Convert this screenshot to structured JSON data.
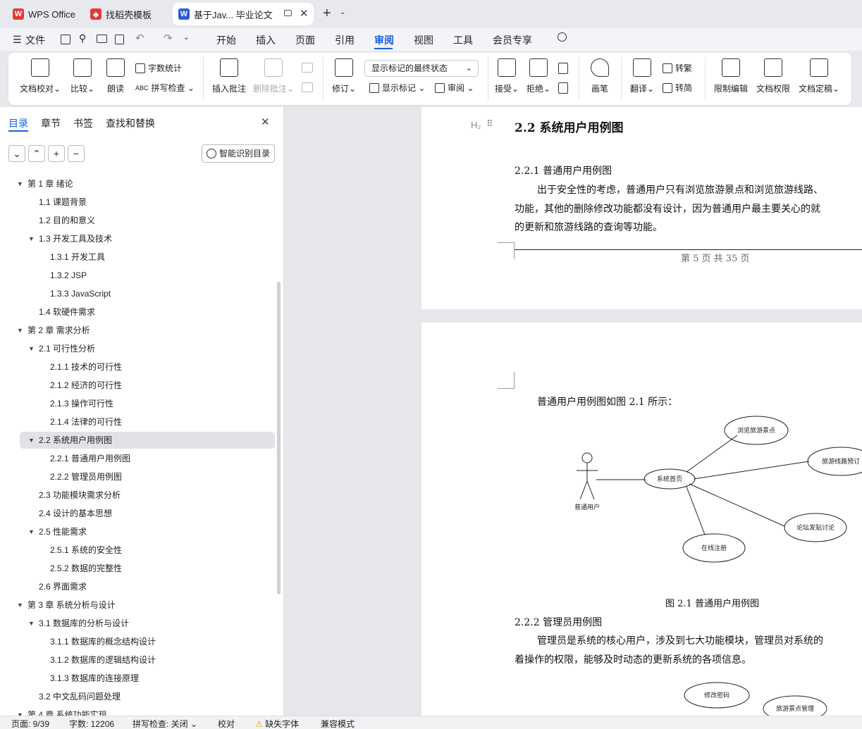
{
  "tabs": [
    {
      "label": "WPS Office"
    },
    {
      "label": "找稻壳模板"
    },
    {
      "label": "基于Jav... 毕业论文"
    }
  ],
  "menu": {
    "file": "文件",
    "items": [
      "开始",
      "插入",
      "页面",
      "引用",
      "审阅",
      "视图",
      "工具",
      "会员专享"
    ]
  },
  "ribbon": {
    "doc_check": "文档校对",
    "compare": "比较",
    "read_aloud": "朗读",
    "word_count": "字数统计",
    "spell_check": "拼写检查",
    "insert_comment": "插入批注",
    "delete_comment": "删除批注",
    "revise": "修订",
    "markup_dropdown": "显示标记的最终状态",
    "show_markup": "显示标记",
    "review": "审阅",
    "accept": "接受",
    "reject": "拒绝",
    "pen": "画笔",
    "translate": "翻译",
    "trad": "转繁",
    "simp": "转简",
    "restrict": "限制编辑",
    "permission": "文档权限",
    "finalize": "文档定稿"
  },
  "sidebar": {
    "tabs": [
      "目录",
      "章节",
      "书签",
      "查找和替换"
    ],
    "smart_button": "智能识别目录",
    "toc": [
      {
        "label": "第 1 章   绪论",
        "level": 0,
        "arrow": true
      },
      {
        "label": "1.1  课题背景",
        "level": 1
      },
      {
        "label": "1.2  目的和意义",
        "level": 1
      },
      {
        "label": "1.3  开发工具及技术",
        "level": 1,
        "arrow": true
      },
      {
        "label": "1.3.1  开发工具",
        "level": 2
      },
      {
        "label": "1.3.2    JSP",
        "level": 2
      },
      {
        "label": "1.3.3    JavaScript",
        "level": 2
      },
      {
        "label": "1.4  软硬件需求",
        "level": 1
      },
      {
        "label": "第 2 章   需求分析",
        "level": 0,
        "arrow": true
      },
      {
        "label": "2.1  可行性分析",
        "level": 1,
        "arrow": true
      },
      {
        "label": "2.1.1  技术的可行性",
        "level": 2
      },
      {
        "label": "2.1.2  经济的可行性",
        "level": 2
      },
      {
        "label": "2.1.3  操作可行性",
        "level": 2
      },
      {
        "label": "2.1.4  法律的可行性",
        "level": 2
      },
      {
        "label": "2.2  系统用户用例图",
        "level": 1,
        "arrow": true,
        "selected": true
      },
      {
        "label": "2.2.1  普通用户用例图",
        "level": 2
      },
      {
        "label": "2.2.2  管理员用例图",
        "level": 2
      },
      {
        "label": "2.3  功能模块需求分析",
        "level": 1
      },
      {
        "label": "2.4  设计的基本思想",
        "level": 1
      },
      {
        "label": "2.5  性能需求",
        "level": 1,
        "arrow": true
      },
      {
        "label": "2.5.1  系统的安全性",
        "level": 2
      },
      {
        "label": "2.5.2  数据的完整性",
        "level": 2
      },
      {
        "label": "2.6  界面需求",
        "level": 1
      },
      {
        "label": "第 3 章   系统分析与设计",
        "level": 0,
        "arrow": true
      },
      {
        "label": "3.1  数据库的分析与设计",
        "level": 1,
        "arrow": true
      },
      {
        "label": "3.1.1  数据库的概念结构设计",
        "level": 2
      },
      {
        "label": "3.1.2  数据库的逻辑结构设计",
        "level": 2
      },
      {
        "label": "3.1.3  数据库的连接原理",
        "level": 2
      },
      {
        "label": "3.2  中文乱码问题处理",
        "level": 1
      },
      {
        "label": "第 4 章   系统功能实现",
        "level": 0,
        "arrow": true
      }
    ]
  },
  "document": {
    "heading_marker": "H₂",
    "section_title": "2.2  系统用户用例图",
    "sub1_title": "2.2.1  普通用户用例图",
    "para1_line1": "出于安全性的考虑，普通用户只有浏览旅游景点和浏览旅游线路、",
    "para1_line2": "功能，其他的删除修改功能都没有设计，因为普通用户最主要关心的就",
    "para1_line3": "的更新和旅游线路的查询等功能。",
    "footer": "第  5  页  共  35  页",
    "intro": "普通用户用例图如图 2.1 所示：",
    "diagram": {
      "actor": "普通用户",
      "center": "系统首页",
      "uc1": "浏览旅游景点",
      "uc2": "旅游线路预订",
      "uc3": "论坛发贴讨论",
      "uc4": "在线注册"
    },
    "caption": "图 2.1    普通用户用例图",
    "sub2_title": "2.2.2  管理员用例图",
    "para2_line1": "管理员是系统的核心用户，涉及到七大功能模块，管理员对系统的",
    "para2_line2": "着操作的权限，能够及时动态的更新系统的各项信息。",
    "diagram2": {
      "uc1": "修改密码",
      "uc2": "旅游景点管理"
    }
  },
  "status": {
    "page": "页面: 9/39",
    "words": "字数: 12206",
    "spell": "拼写检查: 关闭",
    "proof": "校对",
    "missing_font": "缺失字体",
    "compat": "兼容模式"
  },
  "colors": {
    "accent": "#1a5fe0",
    "wps_red": "#e53935",
    "word_blue": "#2b5cd8"
  }
}
